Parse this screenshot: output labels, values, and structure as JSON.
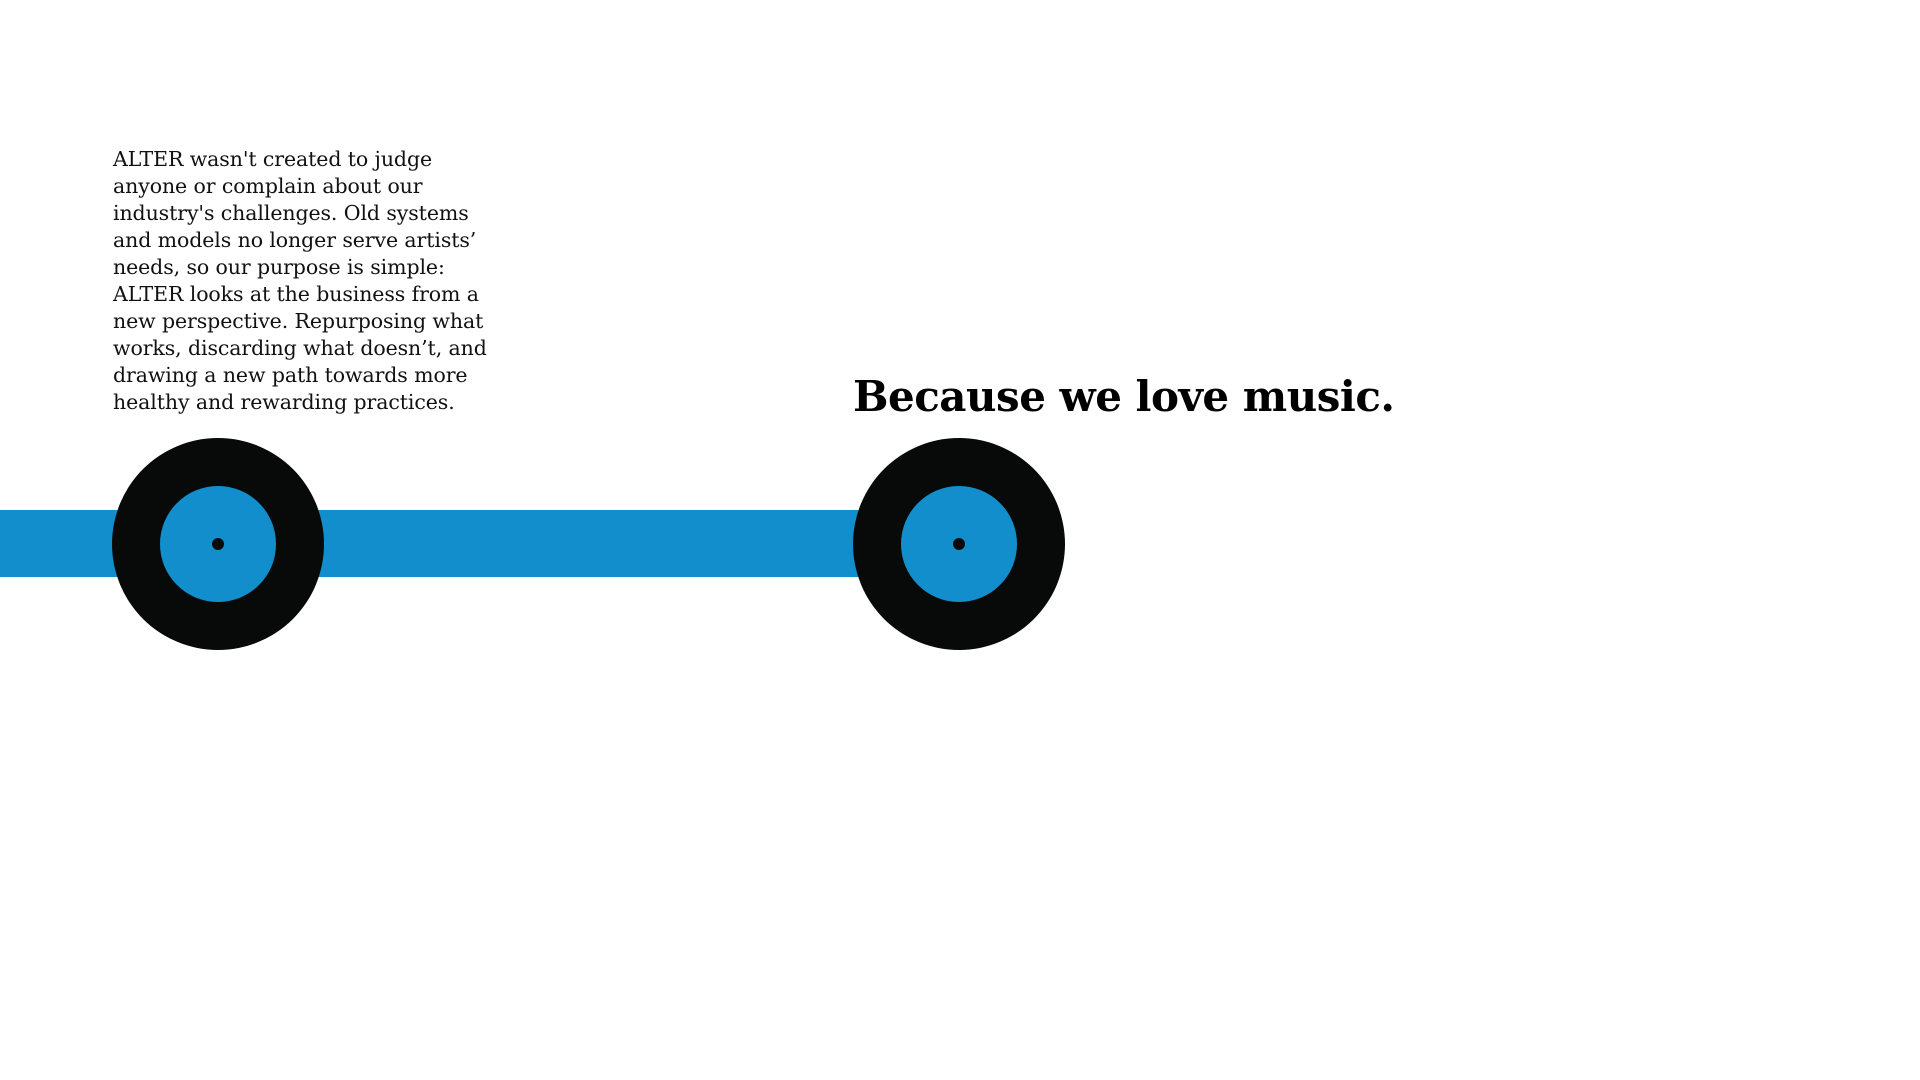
{
  "intro": {
    "lines": [
      "ALTER wasn't created to judge",
      "anyone or complain about our",
      "industry's challenges. Old systems",
      "and models no longer serve artists’",
      "needs, so our purpose is simple:",
      "ALTER looks at the business from a",
      "new perspective. Repurposing what",
      "works, discarding what doesn’t, and",
      "drawing a new path towards more",
      "healthy and rewarding practices."
    ]
  },
  "headline": "Because we love music.",
  "colors": {
    "accent_blue": "#128ecd",
    "record_black": "#080a0a",
    "text": "#111111",
    "background": "#ffffff"
  },
  "icons": {
    "record_left": "vinyl-record-icon",
    "record_right": "vinyl-record-icon"
  }
}
